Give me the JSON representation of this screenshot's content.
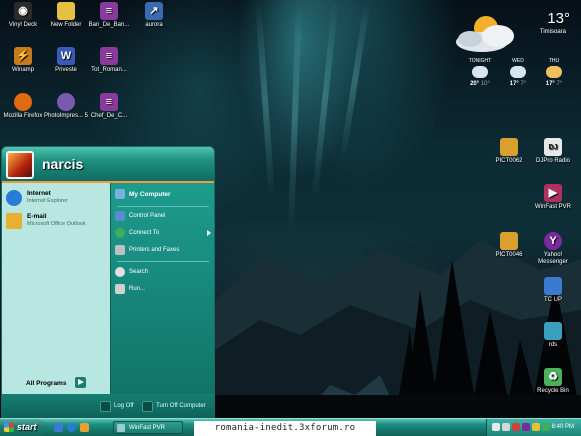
{
  "desktop": {
    "icons_left": [
      {
        "label": "Vinyl Deck",
        "icon": "vinyl-deck-icon",
        "color": "#2a2a2a"
      },
      {
        "label": "New Folder",
        "icon": "folder-icon",
        "color": "#e8c040"
      },
      {
        "label": "Ban_De_Ban...",
        "icon": "winrar-archive-icon",
        "color": "#8a3a9a"
      },
      {
        "label": "aurora",
        "icon": "shortcut-icon",
        "color": "#3a6ab0"
      },
      {
        "label": "Winamp",
        "icon": "winamp-icon",
        "color": "#c87a20"
      },
      {
        "label": "Priveste",
        "icon": "word-document-icon",
        "color": "#3a5ab8"
      },
      {
        "label": "Tot_Roman...",
        "icon": "winrar-archive-icon",
        "color": "#8a3a9a"
      },
      {
        "label": "Mozilla Firefox",
        "icon": "firefox-icon",
        "color": "#e06a10"
      },
      {
        "label": "PhotoImpres... 5",
        "icon": "photoimpression-icon",
        "color": "#7a5ab0"
      },
      {
        "label": "Chef_De_C...",
        "icon": "winrar-archive-icon",
        "color": "#8a3a9a"
      }
    ],
    "icons_right": [
      {
        "label": "PICT0062",
        "icon": "image-file-icon",
        "color": "#d9a030"
      },
      {
        "label": "DJPro Radio",
        "icon": "djpro-radio-icon",
        "color": "#e8e8e8"
      },
      {
        "label": "WinFast PVR",
        "icon": "winfast-pvr-icon",
        "color": "#b03060"
      },
      {
        "label": "PICT0046",
        "icon": "image-file-icon",
        "color": "#d9a030"
      },
      {
        "label": "Yahoo! Messenger",
        "icon": "yahoo-messenger-icon",
        "color": "#7a2a9a"
      },
      {
        "label": "TC UP",
        "icon": "tc-up-icon",
        "color": "#3a7ad0"
      },
      {
        "label": "rds",
        "icon": "rds-icon",
        "color": "#3aa0c0"
      },
      {
        "label": "Recycle Bin",
        "icon": "recycle-bin-icon",
        "color": "#4ab05a"
      }
    ]
  },
  "weather": {
    "temperature": "13°",
    "city": "Timisoara",
    "forecast": [
      {
        "day": "TONIGHT",
        "hi": "20°",
        "lo": "10°"
      },
      {
        "day": "WED",
        "hi": "17°",
        "lo": "7°"
      },
      {
        "day": "THU",
        "hi": "17°",
        "lo": "7°"
      }
    ]
  },
  "start_menu": {
    "user": "narcis",
    "pinned": [
      {
        "title": "Internet",
        "subtitle": "Internet Explorer",
        "icon": "internet-explorer-icon",
        "color": "#2a7ad8"
      },
      {
        "title": "E-mail",
        "subtitle": "Microsoft Office Outlook",
        "icon": "outlook-icon",
        "color": "#e8b030"
      }
    ],
    "all_programs": "All Programs",
    "right_items": [
      {
        "label": "My Computer",
        "icon": "my-computer-icon",
        "color": "#7ab0e0"
      },
      {
        "label": "Control Panel",
        "icon": "control-panel-icon",
        "color": "#5a8ad0"
      },
      {
        "label": "Connect To",
        "icon": "connect-to-icon",
        "color": "#3ab05a"
      },
      {
        "label": "Printers and Faxes",
        "icon": "printer-icon",
        "color": "#c0c0c0"
      },
      {
        "label": "Search",
        "icon": "search-icon",
        "color": "#e0e0e0"
      },
      {
        "label": "Run...",
        "icon": "run-icon",
        "color": "#d0d0d0"
      }
    ],
    "log_off": "Log Off",
    "turn_off": "Turn Off Computer"
  },
  "taskbar": {
    "start_label": "start",
    "active_task": "WinFast PVR",
    "clock": "8:40 PM",
    "quick_launch": [
      {
        "icon": "show-desktop-icon",
        "color": "#3a7ad0"
      },
      {
        "icon": "internet-explorer-icon",
        "color": "#2a7ad8"
      },
      {
        "icon": "media-player-icon",
        "color": "#e8a030"
      }
    ],
    "tray": [
      {
        "icon": "network-icon",
        "color": "#e8e8e8"
      },
      {
        "icon": "volume-icon",
        "color": "#d8d8d8"
      },
      {
        "icon": "antivirus-icon",
        "color": "#d04040"
      },
      {
        "icon": "messenger-icon",
        "color": "#7a2a9a"
      },
      {
        "icon": "update-icon",
        "color": "#e8c030"
      },
      {
        "icon": "security-icon",
        "color": "#3ab050"
      }
    ]
  },
  "watermark": "romania-inedit.3xforum.ro"
}
